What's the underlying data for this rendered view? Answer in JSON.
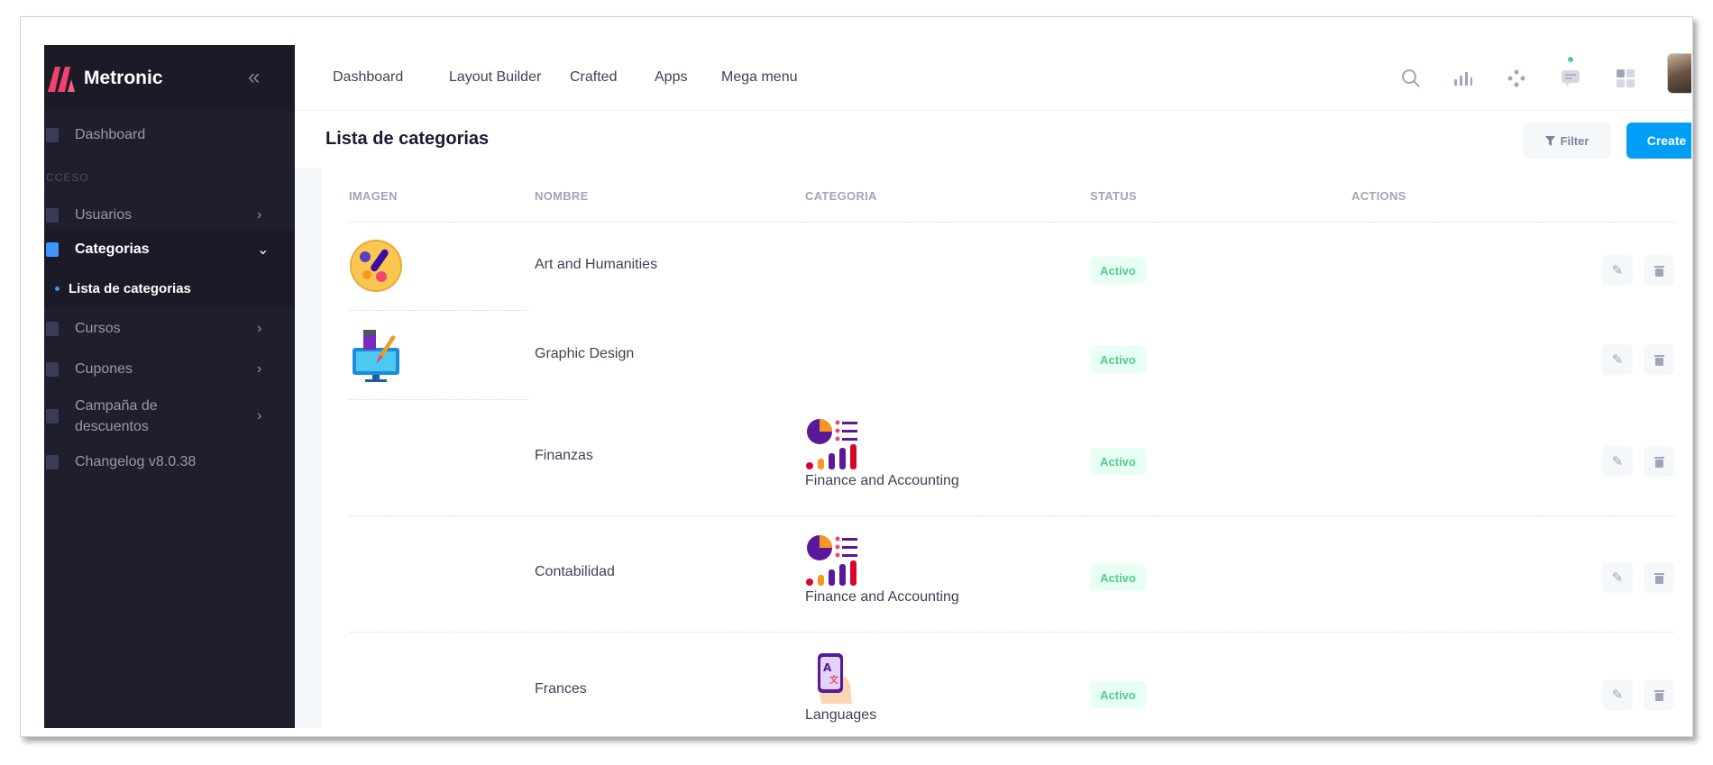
{
  "sidebar": {
    "brand": "Metronic",
    "collapse_glyph": "«",
    "items": [
      {
        "label": "Dashboard",
        "icon": "dashboard-icon"
      },
      {
        "section": "CCESO"
      },
      {
        "label": "Usuarios",
        "icon": "users-icon",
        "arrow": "›"
      },
      {
        "label": "Categorias",
        "icon": "categories-icon",
        "arrow": "⌄",
        "active": true
      },
      {
        "label": "Lista de categorias",
        "sub": true
      },
      {
        "label": "Cursos",
        "icon": "courses-icon",
        "arrow": "›"
      },
      {
        "label": "Cupones",
        "icon": "coupons-icon",
        "arrow": "›"
      },
      {
        "label": "Campaña de descuentos",
        "line1": "Campaña de",
        "line2": "descuentos",
        "icon": "campaign-icon",
        "arrow": "›"
      },
      {
        "label": "Changelog v8.0.38",
        "icon": "changelog-icon"
      }
    ]
  },
  "header": {
    "nav": [
      "Dashboard",
      "Layout Builder",
      "Crafted",
      "Apps",
      "Mega menu"
    ]
  },
  "toolbar": {
    "title": "Lista de categorias",
    "filter_label": "Filter",
    "create_label": "Create"
  },
  "table": {
    "headers": [
      "IMAGEN",
      "NOMBRE",
      "CATEGORIA",
      "STATUS",
      "ACTIONS"
    ],
    "rows": [
      {
        "image": "palette-icon",
        "name": "Art and Humanities",
        "category": "",
        "status": "Activo"
      },
      {
        "image": "design-monitor-icon",
        "name": "Graphic Design",
        "category": "",
        "status": "Activo"
      },
      {
        "image": "",
        "name": "Finanzas",
        "category": "Finance and Accounting",
        "category_icon": "finance-chart-icon",
        "status": "Activo"
      },
      {
        "image": "",
        "name": "Contabilidad",
        "category": "Finance and Accounting",
        "category_icon": "finance-chart-icon",
        "status": "Activo"
      },
      {
        "image": "",
        "name": "Frances",
        "category": "Languages",
        "category_icon": "languages-phone-icon",
        "status": "Activo"
      }
    ]
  },
  "colors": {
    "sidebar_bg": "#1e1e2d",
    "primary": "#009ef7",
    "success": "#50cd89",
    "brand_logo": "#f1416c"
  }
}
